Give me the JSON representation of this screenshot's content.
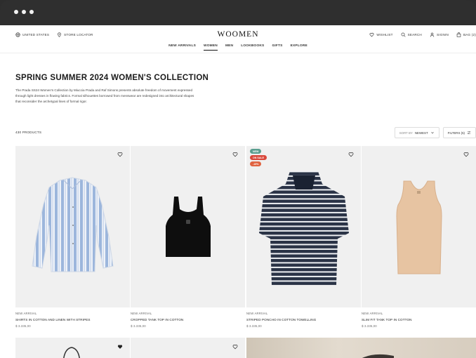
{
  "header": {
    "country": "UNITED STATES",
    "store_locator": "STORE LOCATOR",
    "logo": "WOOMEN",
    "wishlist": "WISHLIST",
    "search": "SEARCH",
    "signin": "SIGNIN",
    "bag": "BAG (2)"
  },
  "nav": [
    "NEW ARRIVALS",
    "WOMEN",
    "MEN",
    "LOOKBOOKS",
    "GIFTS",
    "EXPLORE"
  ],
  "hero": {
    "title": "SPRING SUMMER 2024 WOMEN'S COLLECTION",
    "description": "The Prada SS24 Women's Collection by Miuccia Prada and Raf Simons presents absolute freedom of movement expressed through light dresses in flowing fabrics. Formal silhouettes borrowed from menswear are redesigned into architectural shapes that reconsider the archetypal lines of formal rigor."
  },
  "listing": {
    "count": "430 PRODUCTS",
    "sort_label": "SORT BY",
    "sort_value": "NEWEST",
    "filters": "FILTERS (5)"
  },
  "products": [
    {
      "tag": "NEW ARRIVAL",
      "name": "SHIRTS IN COTTON AND LINEN WITH STRIPES",
      "price": "$ 3.335,00",
      "badges": []
    },
    {
      "tag": "NEW ARRIVAL",
      "name": "CROPPED TANK TOP IN COTTON",
      "price": "$ 3.335,00",
      "badges": []
    },
    {
      "tag": "NEW ARRIVAL",
      "name": "STRIPED PONCHO IN COTTON TOWELLING",
      "price": "$ 3.335,00",
      "badges": [
        "NEW",
        "ON SALE",
        "-15%"
      ]
    },
    {
      "tag": "NEW ARRIVAL",
      "name": "SLIM FIT TANK TOP IN COTTON",
      "price": "$ 3.335,00",
      "badges": []
    }
  ],
  "colors": {
    "badge_new": "#5a9e8f",
    "badge_sale": "#d9483b",
    "badge_discount": "#e0623f"
  }
}
